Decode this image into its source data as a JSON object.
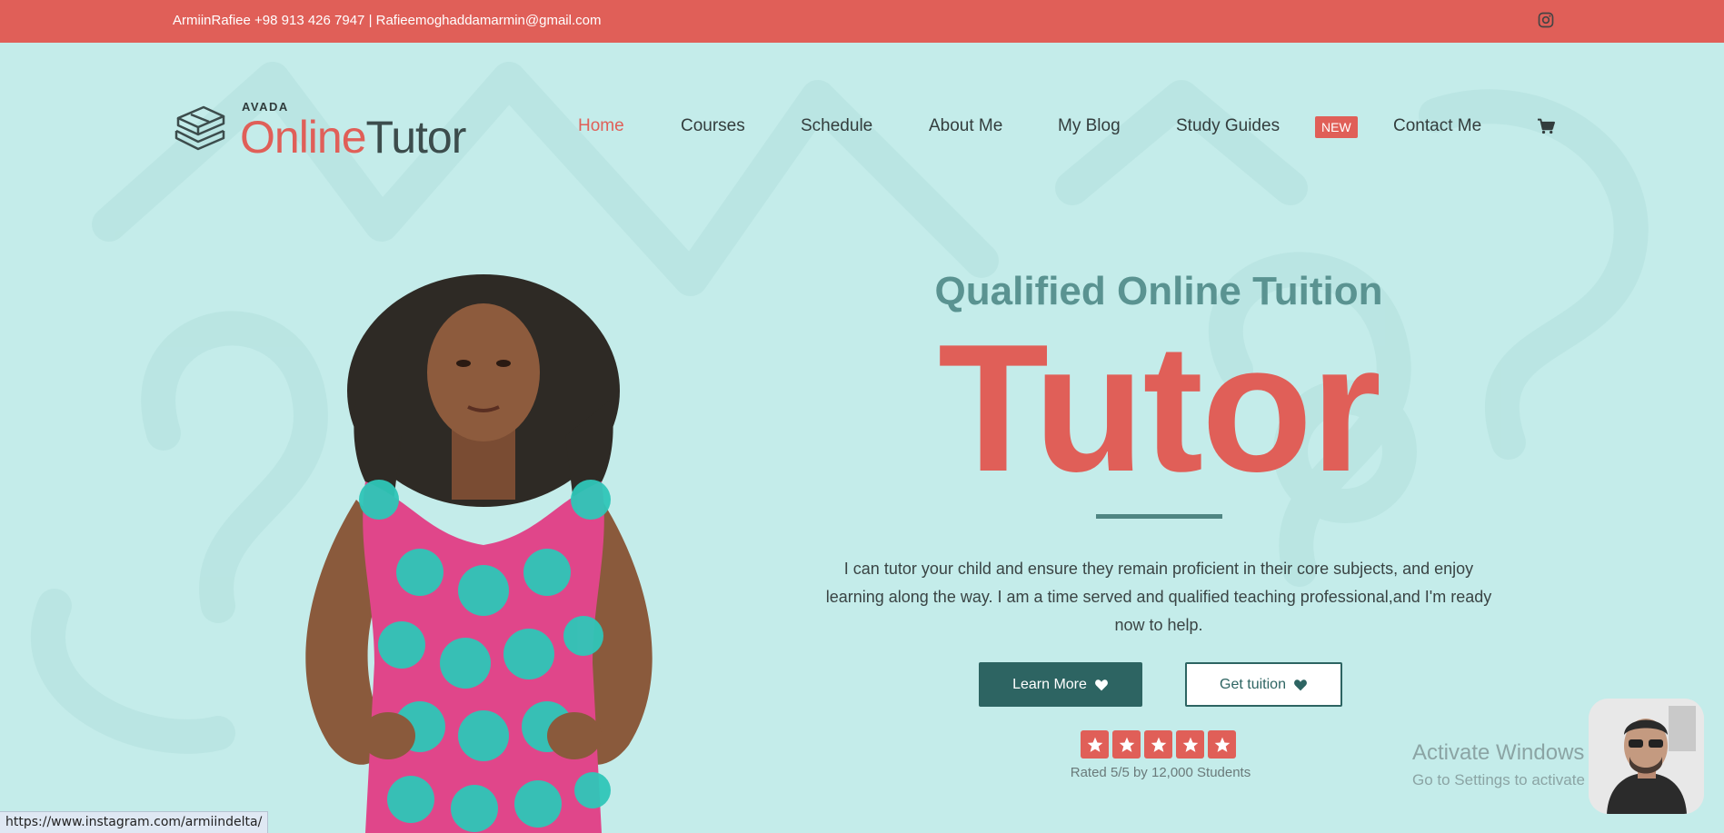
{
  "topbar": {
    "contact": "ArmiinRafiee +98 913 426 7947 | Rafieemoghaddamarmin@gmail.com",
    "social_icon": "instagram-icon"
  },
  "logo": {
    "small_text": "AVADA",
    "main_part1": "Online",
    "main_part2": "Tutor"
  },
  "nav": {
    "items": [
      "Home",
      "Courses",
      "Schedule",
      "About Me",
      "My Blog",
      "Study Guides",
      "Contact Me"
    ],
    "active": "Home",
    "badge": "NEW",
    "cart_icon": "cart-icon"
  },
  "hero": {
    "subtitle": "Qualified Online Tuition",
    "title": "Tutor",
    "description": "I can tutor your child and ensure they remain proficient in their core subjects, and enjoy learning along the way. I am a time served and qualified teaching professional,and I'm ready now to help.",
    "primary_button": "Learn More",
    "secondary_button": "Get tuition",
    "button_icon": "heart-icon",
    "rating_stars": 5,
    "rating_text": "Rated 5/5 by 12,000 Students"
  },
  "watermark": {
    "title": "Activate Windows",
    "subtitle": "Go to Settings to activate Windows."
  },
  "status_bar": {
    "url": "https://www.instagram.com/armiindelta/"
  },
  "colors": {
    "accent": "#e05f58",
    "background": "#c4ecea",
    "teal_dark": "#2d6462",
    "teal_mid": "#5a9391"
  }
}
